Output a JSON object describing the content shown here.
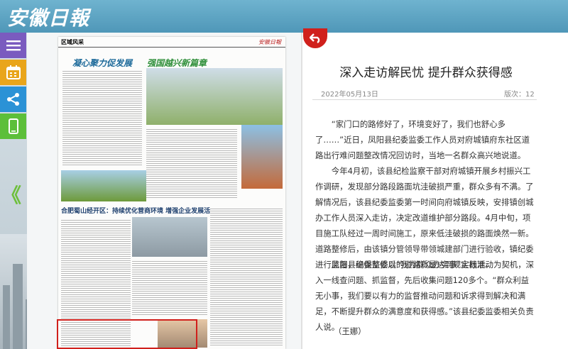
{
  "header": {
    "logo_text": "安徽日報"
  },
  "toolbar": {
    "icons": [
      "menu-icon",
      "calendar-icon",
      "share-icon",
      "mobile-icon"
    ]
  },
  "nav": {
    "back_arrows": "《"
  },
  "newspaper": {
    "section_label": "区域风采",
    "masthead": "安徽日報",
    "headline_left": "凝心聚力促发展",
    "headline_right": "强国越兴新篇章",
    "section2_title": "合肥蜀山经开区：持续优化营商环境 增强企业发展活力"
  },
  "article": {
    "title": "深入走访解民忧 提升群众获得感",
    "date": "2022年05月13日",
    "edition": "版次：12",
    "paragraphs": [
      "“家门口的路修好了，环境变好了，我们也舒心多了……”近日，凤阳县纪委监委工作人员对府城镇府东社区道路出行难问题整改情况回访时，当地一名群众高兴地说道。",
      "今年4月初，该县纪检监察干部对府城镇开展乡村振兴工作调研，发现部分路段路面坑洼破损严重，群众多有不满。了解情况后，该县纪委监委第一时间向府城镇反映，安排镇创城办工作人员深入走访，决定改道维护部分路段。4月中旬，项目施工队经过一周时间施工，原来低洼破损的路面焕然一新。道路整修后，由该镇分管领导带领城建部门进行验收，镇纪委进行监督，确保整修后的道路质量达到规定标准。",
      "凤阳县纪委监委以“我为群众办实事”实践活动为契机，深入一线查问题、抓监督，先后收集问题120多个。“群众利益无小事，我们要以有力的监督推动问题和诉求得到解决和满足，不断提升群众的满意度和获得感。”该县纪委监委相关负责人说。"
    ],
    "author": "（王娜）"
  },
  "colors": {
    "topbar": "#5aa3c4",
    "accent": "#d0201c",
    "menu": "#7a5bbf",
    "calendar": "#e9a51b",
    "share": "#2b92d6",
    "mobile": "#5cbf3a"
  }
}
